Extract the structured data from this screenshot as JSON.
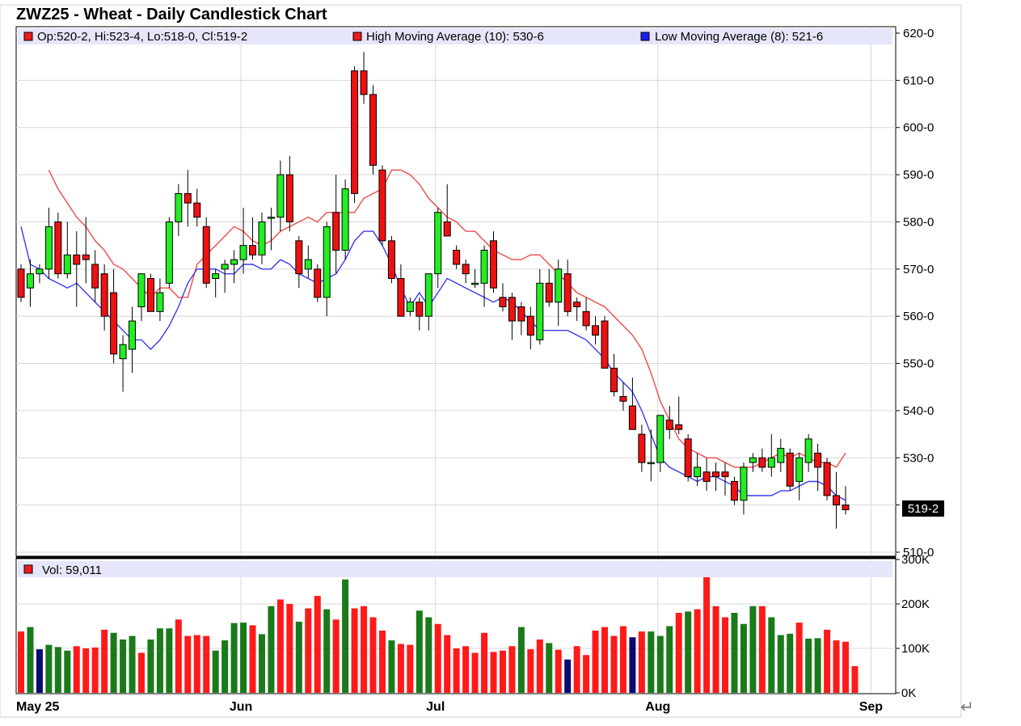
{
  "chart_data": {
    "type": "candlestick",
    "title": "ZWZ25 - Wheat - Daily Candlestick Chart",
    "price_panel": {
      "legend": [
        {
          "label": "Op:520-2, Hi:523-4, Lo:518-0, Cl:519-2",
          "color": "#ee1c1c"
        },
        {
          "label": "High Moving Average (10): 530-6",
          "color": "#ee1c1c"
        },
        {
          "label": "Low Moving Average (8): 521-6",
          "color": "#1c1cee"
        }
      ],
      "ylim": [
        510,
        620
      ],
      "y_ticks": [
        "620-0",
        "610-0",
        "600-0",
        "590-0",
        "580-0",
        "570-0",
        "560-0",
        "550-0",
        "540-0",
        "530-0",
        "520-0",
        "510-0"
      ],
      "last_price_label": "519-2",
      "last_price": 519.25,
      "candles": [
        {
          "o": 570,
          "h": 571,
          "l": 563,
          "c": 564
        },
        {
          "o": 566,
          "h": 572,
          "l": 562,
          "c": 569
        },
        {
          "o": 569,
          "h": 571,
          "l": 567,
          "c": 570
        },
        {
          "o": 570,
          "h": 583,
          "l": 568,
          "c": 579
        },
        {
          "o": 580,
          "h": 582,
          "l": 568,
          "c": 569
        },
        {
          "o": 569,
          "h": 580,
          "l": 568,
          "c": 573
        },
        {
          "o": 573,
          "h": 578,
          "l": 562,
          "c": 571
        },
        {
          "o": 573,
          "h": 581,
          "l": 567,
          "c": 572
        },
        {
          "o": 571,
          "h": 574,
          "l": 563,
          "c": 566
        },
        {
          "o": 569,
          "h": 571,
          "l": 557,
          "c": 560
        },
        {
          "o": 565,
          "h": 570,
          "l": 550,
          "c": 552
        },
        {
          "o": 551,
          "h": 556,
          "l": 544,
          "c": 554
        },
        {
          "o": 553,
          "h": 562,
          "l": 548,
          "c": 559
        },
        {
          "o": 562,
          "h": 569,
          "l": 559,
          "c": 569
        },
        {
          "o": 568,
          "h": 569,
          "l": 561,
          "c": 561
        },
        {
          "o": 561,
          "h": 568,
          "l": 559,
          "c": 565
        },
        {
          "o": 567,
          "h": 581,
          "l": 566,
          "c": 580
        },
        {
          "o": 580,
          "h": 588,
          "l": 577,
          "c": 586
        },
        {
          "o": 586,
          "h": 591,
          "l": 579,
          "c": 584
        },
        {
          "o": 584,
          "h": 587,
          "l": 579,
          "c": 581
        },
        {
          "o": 579,
          "h": 581,
          "l": 566,
          "c": 567
        },
        {
          "o": 568,
          "h": 570,
          "l": 564,
          "c": 569
        },
        {
          "o": 570,
          "h": 572,
          "l": 565,
          "c": 571
        },
        {
          "o": 571,
          "h": 574,
          "l": 567,
          "c": 572
        },
        {
          "o": 572,
          "h": 583,
          "l": 569,
          "c": 575
        },
        {
          "o": 575,
          "h": 581,
          "l": 572,
          "c": 573
        },
        {
          "o": 573,
          "h": 582,
          "l": 571,
          "c": 580
        },
        {
          "o": 581,
          "h": 583,
          "l": 574,
          "c": 581
        },
        {
          "o": 581,
          "h": 593,
          "l": 578,
          "c": 590
        },
        {
          "o": 590,
          "h": 594,
          "l": 578,
          "c": 580
        },
        {
          "o": 576,
          "h": 577,
          "l": 566,
          "c": 569
        },
        {
          "o": 570,
          "h": 575,
          "l": 568,
          "c": 572
        },
        {
          "o": 570,
          "h": 571,
          "l": 563,
          "c": 564
        },
        {
          "o": 564,
          "h": 580,
          "l": 560,
          "c": 579
        },
        {
          "o": 582,
          "h": 590,
          "l": 569,
          "c": 574
        },
        {
          "o": 574,
          "h": 589,
          "l": 572,
          "c": 587
        },
        {
          "o": 612,
          "h": 613,
          "l": 584,
          "c": 586
        },
        {
          "o": 612,
          "h": 616,
          "l": 605,
          "c": 607
        },
        {
          "o": 607,
          "h": 609,
          "l": 590,
          "c": 592
        },
        {
          "o": 591,
          "h": 592,
          "l": 575,
          "c": 576
        },
        {
          "o": 576,
          "h": 577,
          "l": 567,
          "c": 568
        },
        {
          "o": 568,
          "h": 571,
          "l": 560,
          "c": 560
        },
        {
          "o": 561,
          "h": 564,
          "l": 560,
          "c": 563
        },
        {
          "o": 563,
          "h": 564,
          "l": 557,
          "c": 560
        },
        {
          "o": 560,
          "h": 567,
          "l": 557,
          "c": 569
        },
        {
          "o": 569,
          "h": 583,
          "l": 566,
          "c": 582
        },
        {
          "o": 580,
          "h": 588,
          "l": 577,
          "c": 577
        },
        {
          "o": 574,
          "h": 575,
          "l": 570,
          "c": 571
        },
        {
          "o": 571,
          "h": 572,
          "l": 567,
          "c": 569
        },
        {
          "o": 567,
          "h": 570,
          "l": 566,
          "c": 567
        },
        {
          "o": 567,
          "h": 575,
          "l": 562,
          "c": 574
        },
        {
          "o": 576,
          "h": 578,
          "l": 565,
          "c": 566
        },
        {
          "o": 564,
          "h": 567,
          "l": 561,
          "c": 562
        },
        {
          "o": 564,
          "h": 565,
          "l": 555,
          "c": 559
        },
        {
          "o": 562,
          "h": 563,
          "l": 556,
          "c": 559
        },
        {
          "o": 560,
          "h": 562,
          "l": 553,
          "c": 556
        },
        {
          "o": 555,
          "h": 570,
          "l": 554,
          "c": 567
        },
        {
          "o": 567,
          "h": 570,
          "l": 562,
          "c": 563
        },
        {
          "o": 563,
          "h": 572,
          "l": 558,
          "c": 570
        },
        {
          "o": 569,
          "h": 572,
          "l": 560,
          "c": 561
        },
        {
          "o": 563,
          "h": 564,
          "l": 559,
          "c": 562
        },
        {
          "o": 561,
          "h": 564,
          "l": 557,
          "c": 558
        },
        {
          "o": 558,
          "h": 560,
          "l": 554,
          "c": 556
        },
        {
          "o": 559,
          "h": 560,
          "l": 549,
          "c": 549
        },
        {
          "o": 549,
          "h": 552,
          "l": 543,
          "c": 544
        },
        {
          "o": 543,
          "h": 546,
          "l": 540,
          "c": 542
        },
        {
          "o": 541,
          "h": 547,
          "l": 537,
          "c": 536
        },
        {
          "o": 535,
          "h": 537,
          "l": 527,
          "c": 529
        },
        {
          "o": 529,
          "h": 536,
          "l": 525,
          "c": 529
        },
        {
          "o": 529,
          "h": 539,
          "l": 527,
          "c": 539
        },
        {
          "o": 538,
          "h": 541,
          "l": 534,
          "c": 536
        },
        {
          "o": 537,
          "h": 543,
          "l": 535,
          "c": 536
        },
        {
          "o": 534,
          "h": 535,
          "l": 525,
          "c": 526
        },
        {
          "o": 526,
          "h": 531,
          "l": 524,
          "c": 528
        },
        {
          "o": 527,
          "h": 530,
          "l": 523,
          "c": 525
        },
        {
          "o": 527,
          "h": 529,
          "l": 523,
          "c": 526
        },
        {
          "o": 527,
          "h": 529,
          "l": 522,
          "c": 526
        },
        {
          "o": 525,
          "h": 526,
          "l": 520,
          "c": 521
        },
        {
          "o": 521,
          "h": 529,
          "l": 518,
          "c": 528
        },
        {
          "o": 529,
          "h": 531,
          "l": 527,
          "c": 530
        },
        {
          "o": 530,
          "h": 532,
          "l": 527,
          "c": 528
        },
        {
          "o": 528,
          "h": 535,
          "l": 526,
          "c": 530
        },
        {
          "o": 529,
          "h": 534,
          "l": 527,
          "c": 532
        },
        {
          "o": 531,
          "h": 532,
          "l": 523,
          "c": 524
        },
        {
          "o": 525,
          "h": 531,
          "l": 521,
          "c": 530
        },
        {
          "o": 529,
          "h": 535,
          "l": 527,
          "c": 534
        },
        {
          "o": 531,
          "h": 533,
          "l": 523,
          "c": 528
        },
        {
          "o": 529,
          "h": 530,
          "l": 521,
          "c": 522
        },
        {
          "o": 522,
          "h": 527,
          "l": 515,
          "c": 520
        },
        {
          "o": 520,
          "h": 524,
          "l": 518,
          "c": 519
        }
      ],
      "high_ma": [
        591,
        587,
        584,
        581,
        579,
        576,
        574,
        571,
        570,
        568,
        566,
        564,
        566,
        566,
        564,
        564,
        571,
        573,
        575,
        577,
        579,
        578,
        576,
        575,
        576,
        578,
        579,
        580,
        581,
        580,
        582,
        582,
        582,
        582,
        585,
        586,
        587,
        591,
        591,
        590,
        588,
        585,
        583,
        581,
        580,
        578,
        578,
        576,
        574,
        573,
        572,
        572,
        573,
        573,
        571,
        569,
        567,
        565,
        564,
        563,
        562,
        560,
        558,
        556,
        553,
        548,
        542,
        538,
        534,
        532,
        531,
        530,
        530,
        529,
        528,
        528,
        528,
        529,
        530,
        531,
        530,
        531,
        530,
        529,
        529,
        528,
        531
      ],
      "low_ma": [
        579,
        571,
        570,
        568,
        567,
        566,
        567,
        565,
        563,
        561,
        559,
        557,
        555,
        555,
        553,
        555,
        558,
        562,
        567,
        570,
        570,
        570,
        569,
        569,
        571,
        571,
        570,
        570,
        572,
        571,
        569,
        568,
        567,
        568,
        569,
        572,
        576,
        578,
        578,
        575,
        571,
        566,
        562,
        565,
        562,
        565,
        568,
        567,
        566,
        565,
        564,
        563,
        564,
        563,
        561,
        559,
        557,
        557,
        557,
        557,
        556,
        555,
        553,
        551,
        548,
        546,
        544,
        540,
        535,
        530,
        528,
        527,
        526,
        525,
        526,
        526,
        525,
        524,
        522,
        522,
        522,
        522,
        523,
        523,
        524,
        525,
        525,
        524,
        522,
        521
      ]
    },
    "volume_panel": {
      "legend": "Vol: 59,011",
      "ylim": [
        0,
        300000
      ],
      "y_ticks": [
        "300K",
        "200K",
        "100K",
        "0K"
      ],
      "values": [
        138000,
        148000,
        98000,
        108000,
        103000,
        95000,
        105000,
        100000,
        102000,
        142000,
        135000,
        120000,
        128000,
        90000,
        120000,
        145000,
        145000,
        165000,
        128000,
        130000,
        128000,
        95000,
        118000,
        157000,
        158000,
        152000,
        132000,
        195000,
        210000,
        200000,
        160000,
        190000,
        218000,
        188000,
        165000,
        255000,
        190000,
        195000,
        170000,
        140000,
        118000,
        110000,
        108000,
        185000,
        170000,
        155000,
        130000,
        100000,
        105000,
        90000,
        135000,
        92000,
        95000,
        105000,
        148000,
        98000,
        120000,
        112000,
        97000,
        75000,
        105000,
        85000,
        140000,
        148000,
        128000,
        150000,
        125000,
        138000,
        138000,
        128000,
        150000,
        180000,
        183000,
        188000,
        263000,
        195000,
        170000,
        180000,
        155000,
        195000,
        195000,
        170000,
        130000,
        133000,
        158000,
        122000,
        123000,
        142000,
        118000,
        115000,
        60000
      ],
      "colors": [
        "red",
        "green",
        "navy",
        "green",
        "green",
        "green",
        "red",
        "red",
        "red",
        "red",
        "green",
        "green",
        "green",
        "red",
        "green",
        "green",
        "green",
        "red",
        "red",
        "red",
        "red",
        "green",
        "green",
        "green",
        "green",
        "red",
        "green",
        "green",
        "red",
        "red",
        "green",
        "red",
        "red",
        "green",
        "red",
        "green",
        "red",
        "red",
        "red",
        "red",
        "green",
        "red",
        "red",
        "green",
        "green",
        "red",
        "red",
        "red",
        "red",
        "red",
        "red",
        "red",
        "red",
        "red",
        "green",
        "red",
        "red",
        "green",
        "red",
        "navy",
        "red",
        "red",
        "red",
        "red",
        "red",
        "red",
        "navy",
        "red",
        "green",
        "green",
        "green",
        "red",
        "green",
        "red",
        "red",
        "red",
        "red",
        "green",
        "green",
        "green",
        "red",
        "green",
        "green",
        "green",
        "red",
        "green",
        "green",
        "red",
        "red",
        "red",
        "red"
      ]
    },
    "x_axis": {
      "labels": [
        "May 25",
        "Jun",
        "Jul",
        "Aug",
        "Sep"
      ],
      "label_index": [
        0,
        24,
        45,
        69,
        92
      ]
    }
  },
  "page": {
    "return_glyph": "↵"
  }
}
